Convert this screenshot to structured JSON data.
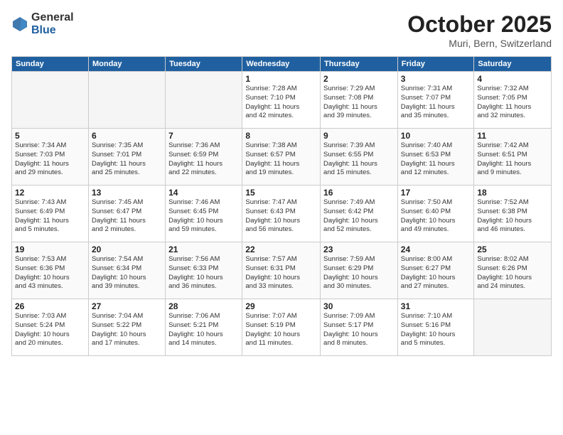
{
  "logo": {
    "general": "General",
    "blue": "Blue"
  },
  "title": "October 2025",
  "location": "Muri, Bern, Switzerland",
  "days_header": [
    "Sunday",
    "Monday",
    "Tuesday",
    "Wednesday",
    "Thursday",
    "Friday",
    "Saturday"
  ],
  "weeks": [
    [
      {
        "day": "",
        "info": ""
      },
      {
        "day": "",
        "info": ""
      },
      {
        "day": "",
        "info": ""
      },
      {
        "day": "1",
        "info": "Sunrise: 7:28 AM\nSunset: 7:10 PM\nDaylight: 11 hours\nand 42 minutes."
      },
      {
        "day": "2",
        "info": "Sunrise: 7:29 AM\nSunset: 7:08 PM\nDaylight: 11 hours\nand 39 minutes."
      },
      {
        "day": "3",
        "info": "Sunrise: 7:31 AM\nSunset: 7:07 PM\nDaylight: 11 hours\nand 35 minutes."
      },
      {
        "day": "4",
        "info": "Sunrise: 7:32 AM\nSunset: 7:05 PM\nDaylight: 11 hours\nand 32 minutes."
      }
    ],
    [
      {
        "day": "5",
        "info": "Sunrise: 7:34 AM\nSunset: 7:03 PM\nDaylight: 11 hours\nand 29 minutes."
      },
      {
        "day": "6",
        "info": "Sunrise: 7:35 AM\nSunset: 7:01 PM\nDaylight: 11 hours\nand 25 minutes."
      },
      {
        "day": "7",
        "info": "Sunrise: 7:36 AM\nSunset: 6:59 PM\nDaylight: 11 hours\nand 22 minutes."
      },
      {
        "day": "8",
        "info": "Sunrise: 7:38 AM\nSunset: 6:57 PM\nDaylight: 11 hours\nand 19 minutes."
      },
      {
        "day": "9",
        "info": "Sunrise: 7:39 AM\nSunset: 6:55 PM\nDaylight: 11 hours\nand 15 minutes."
      },
      {
        "day": "10",
        "info": "Sunrise: 7:40 AM\nSunset: 6:53 PM\nDaylight: 11 hours\nand 12 minutes."
      },
      {
        "day": "11",
        "info": "Sunrise: 7:42 AM\nSunset: 6:51 PM\nDaylight: 11 hours\nand 9 minutes."
      }
    ],
    [
      {
        "day": "12",
        "info": "Sunrise: 7:43 AM\nSunset: 6:49 PM\nDaylight: 11 hours\nand 5 minutes."
      },
      {
        "day": "13",
        "info": "Sunrise: 7:45 AM\nSunset: 6:47 PM\nDaylight: 11 hours\nand 2 minutes."
      },
      {
        "day": "14",
        "info": "Sunrise: 7:46 AM\nSunset: 6:45 PM\nDaylight: 10 hours\nand 59 minutes."
      },
      {
        "day": "15",
        "info": "Sunrise: 7:47 AM\nSunset: 6:43 PM\nDaylight: 10 hours\nand 56 minutes."
      },
      {
        "day": "16",
        "info": "Sunrise: 7:49 AM\nSunset: 6:42 PM\nDaylight: 10 hours\nand 52 minutes."
      },
      {
        "day": "17",
        "info": "Sunrise: 7:50 AM\nSunset: 6:40 PM\nDaylight: 10 hours\nand 49 minutes."
      },
      {
        "day": "18",
        "info": "Sunrise: 7:52 AM\nSunset: 6:38 PM\nDaylight: 10 hours\nand 46 minutes."
      }
    ],
    [
      {
        "day": "19",
        "info": "Sunrise: 7:53 AM\nSunset: 6:36 PM\nDaylight: 10 hours\nand 43 minutes."
      },
      {
        "day": "20",
        "info": "Sunrise: 7:54 AM\nSunset: 6:34 PM\nDaylight: 10 hours\nand 39 minutes."
      },
      {
        "day": "21",
        "info": "Sunrise: 7:56 AM\nSunset: 6:33 PM\nDaylight: 10 hours\nand 36 minutes."
      },
      {
        "day": "22",
        "info": "Sunrise: 7:57 AM\nSunset: 6:31 PM\nDaylight: 10 hours\nand 33 minutes."
      },
      {
        "day": "23",
        "info": "Sunrise: 7:59 AM\nSunset: 6:29 PM\nDaylight: 10 hours\nand 30 minutes."
      },
      {
        "day": "24",
        "info": "Sunrise: 8:00 AM\nSunset: 6:27 PM\nDaylight: 10 hours\nand 27 minutes."
      },
      {
        "day": "25",
        "info": "Sunrise: 8:02 AM\nSunset: 6:26 PM\nDaylight: 10 hours\nand 24 minutes."
      }
    ],
    [
      {
        "day": "26",
        "info": "Sunrise: 7:03 AM\nSunset: 5:24 PM\nDaylight: 10 hours\nand 20 minutes."
      },
      {
        "day": "27",
        "info": "Sunrise: 7:04 AM\nSunset: 5:22 PM\nDaylight: 10 hours\nand 17 minutes."
      },
      {
        "day": "28",
        "info": "Sunrise: 7:06 AM\nSunset: 5:21 PM\nDaylight: 10 hours\nand 14 minutes."
      },
      {
        "day": "29",
        "info": "Sunrise: 7:07 AM\nSunset: 5:19 PM\nDaylight: 10 hours\nand 11 minutes."
      },
      {
        "day": "30",
        "info": "Sunrise: 7:09 AM\nSunset: 5:17 PM\nDaylight: 10 hours\nand 8 minutes."
      },
      {
        "day": "31",
        "info": "Sunrise: 7:10 AM\nSunset: 5:16 PM\nDaylight: 10 hours\nand 5 minutes."
      },
      {
        "day": "",
        "info": ""
      }
    ]
  ]
}
